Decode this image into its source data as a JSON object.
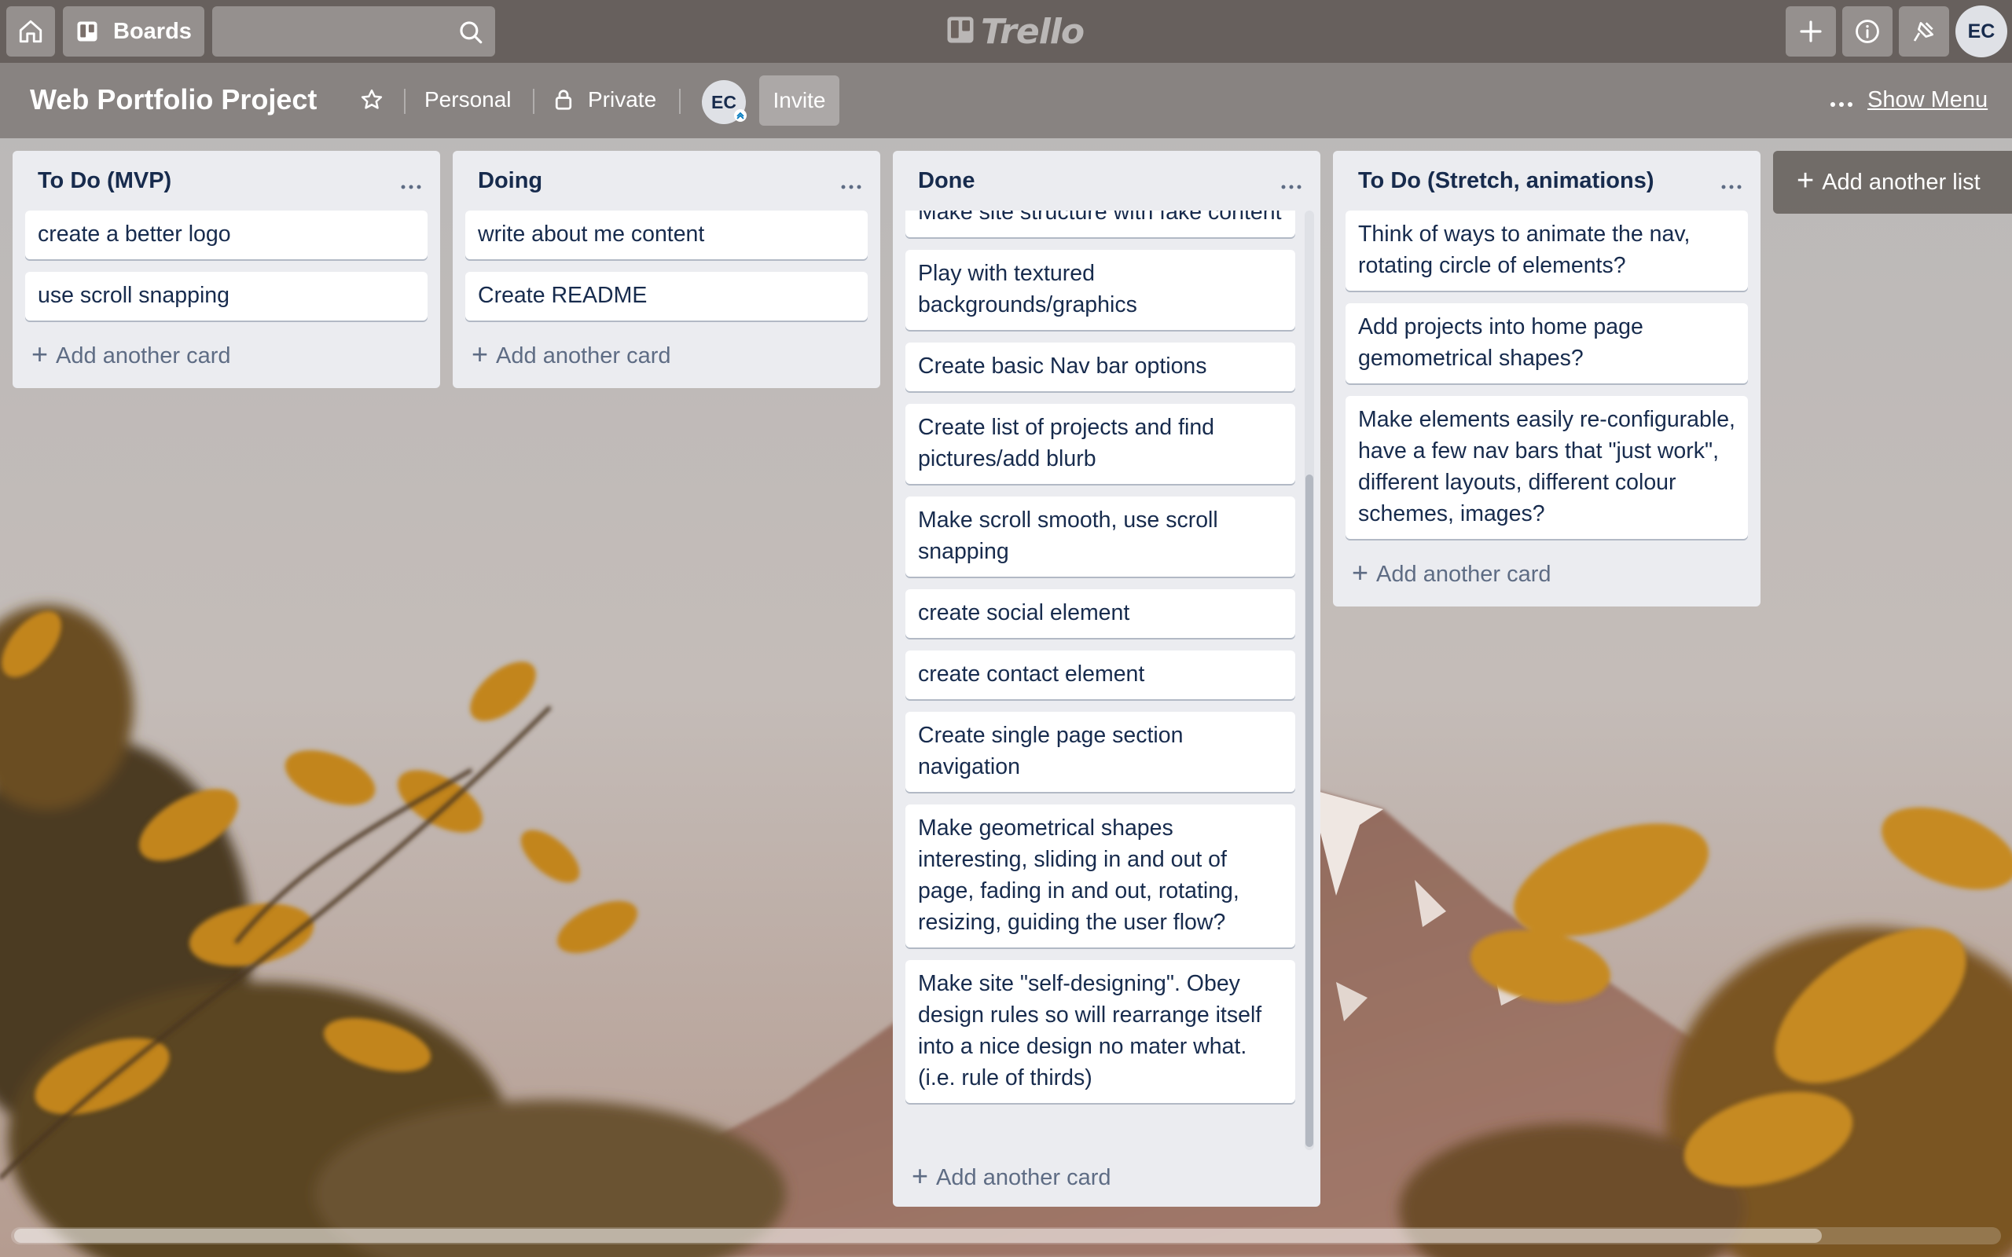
{
  "topbar": {
    "boards_label": "Boards",
    "search_placeholder": "",
    "logo_text": "Trello",
    "user_initials": "EC"
  },
  "board": {
    "title": "Web Portfolio Project",
    "team": "Personal",
    "visibility": "Private",
    "member_initials": "EC",
    "invite_label": "Invite",
    "show_menu_label": "Show Menu"
  },
  "lists": [
    {
      "title": "To Do (MVP)",
      "cards": [
        "create a better logo",
        "use scroll snapping"
      ],
      "add_card_label": "Add another card"
    },
    {
      "title": "Doing",
      "cards": [
        "write about me content",
        "Create README"
      ],
      "add_card_label": "Add another card"
    },
    {
      "title": "Done",
      "cards": [
        "Make site structure with fake content",
        "Play with textured backgrounds/graphics",
        "Create basic Nav bar options",
        "Create list of projects and find pictures/add blurb",
        "Make scroll smooth, use scroll snapping",
        "create social element",
        "create contact element",
        "Create single page section navigation",
        "Make geometrical shapes interesting, sliding in and out of page, fading in and out, rotating, resizing, guiding the user flow?",
        "Make site \"self-designing\". Obey design rules so will rearrange itself into a nice design no mater what. (i.e. rule of thirds)"
      ],
      "add_card_label": "Add another card"
    },
    {
      "title": "To Do (Stretch, animations)",
      "cards": [
        "Think of ways to animate the nav, rotating circle of elements?",
        "Add projects into home page gemometrical shapes?",
        "Make elements easily re-configurable, have a few nav bars that \"just work\", different layouts, different colour schemes, images?"
      ],
      "add_card_label": "Add another card"
    }
  ],
  "add_list_label": "Add another list",
  "colors": {
    "list_bg": "#ebecf0",
    "card_text": "#172b4d",
    "muted_text": "#5e6c84"
  }
}
